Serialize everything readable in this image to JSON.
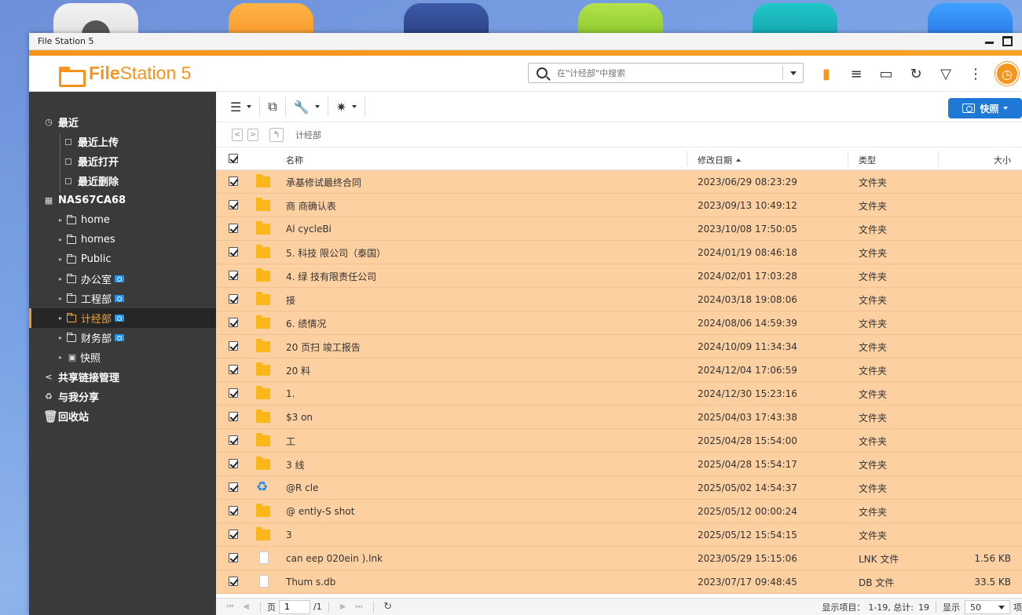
{
  "window": {
    "title": "File Station 5"
  },
  "app": {
    "brand_prefix": "File",
    "brand_suffix": "Station 5"
  },
  "search": {
    "placeholder": "在\"计经部\"中搜索"
  },
  "sidebar": {
    "recent": {
      "label": "最近",
      "children": [
        "最近上传",
        "最近打开",
        "最近删除"
      ]
    },
    "nas": {
      "label": "NAS67CA68"
    },
    "folders": [
      {
        "label": "home",
        "shared": false,
        "selected": false
      },
      {
        "label": "homes",
        "shared": false,
        "selected": false
      },
      {
        "label": "Public",
        "shared": false,
        "selected": false
      },
      {
        "label": "办公室",
        "shared": true,
        "selected": false
      },
      {
        "label": "工程部",
        "shared": true,
        "selected": false
      },
      {
        "label": "计经部",
        "shared": true,
        "selected": true
      },
      {
        "label": "财务部",
        "shared": true,
        "selected": false
      },
      {
        "label": "快照",
        "shared": false,
        "selected": false
      }
    ],
    "share_links": "共享链接管理",
    "shared_with_me": "与我分享",
    "recycle_bin": "回收站"
  },
  "toolbar": {
    "snapshot_label": "快照"
  },
  "path": {
    "current": "计经部"
  },
  "columns": {
    "name": "名称",
    "modified": "修改日期",
    "type": "类型",
    "size": "大小"
  },
  "files": [
    {
      "name": "承基修试最终合同",
      "modified": "2023/06/29 08:23:29",
      "type": "文件夹",
      "size": "",
      "icon": "folder"
    },
    {
      "name": "商 商确认表",
      "modified": "2023/09/13 10:49:12",
      "type": "文件夹",
      "size": "",
      "icon": "folder"
    },
    {
      "name": "Al cycleBi",
      "modified": "2023/10/08 17:50:05",
      "type": "文件夹",
      "size": "",
      "icon": "folder"
    },
    {
      "name": "5. 科技 限公司（泰国）",
      "modified": "2024/01/19 08:46:18",
      "type": "文件夹",
      "size": "",
      "icon": "folder"
    },
    {
      "name": "4. 绿 技有限责任公司",
      "modified": "2024/02/01 17:03:28",
      "type": "文件夹",
      "size": "",
      "icon": "folder"
    },
    {
      "name": "接",
      "modified": "2024/03/18 19:08:06",
      "type": "文件夹",
      "size": "",
      "icon": "folder"
    },
    {
      "name": "6. 绩情况",
      "modified": "2024/08/06 14:59:39",
      "type": "文件夹",
      "size": "",
      "icon": "folder"
    },
    {
      "name": "20 页扫 竣工报告",
      "modified": "2024/10/09 11:34:34",
      "type": "文件夹",
      "size": "",
      "icon": "folder"
    },
    {
      "name": "20 料",
      "modified": "2024/12/04 17:06:59",
      "type": "文件夹",
      "size": "",
      "icon": "folder"
    },
    {
      "name": "1.",
      "modified": "2024/12/30 15:23:16",
      "type": "文件夹",
      "size": "",
      "icon": "folder"
    },
    {
      "name": "$3 on",
      "modified": "2025/04/03 17:43:38",
      "type": "文件夹",
      "size": "",
      "icon": "folder"
    },
    {
      "name": "工",
      "modified": "2025/04/28 15:54:00",
      "type": "文件夹",
      "size": "",
      "icon": "folder"
    },
    {
      "name": "3 线",
      "modified": "2025/04/28 15:54:17",
      "type": "文件夹",
      "size": "",
      "icon": "folder"
    },
    {
      "name": "@R cle",
      "modified": "2025/05/02 14:54:37",
      "type": "文件夹",
      "size": "",
      "icon": "recycle"
    },
    {
      "name": "@ ently-S shot",
      "modified": "2025/05/12 00:00:24",
      "type": "文件夹",
      "size": "",
      "icon": "folder"
    },
    {
      "name": "3",
      "modified": "2025/05/12 15:54:15",
      "type": "文件夹",
      "size": "",
      "icon": "folder"
    },
    {
      "name": "can eep 020ein ).lnk",
      "modified": "2023/05/29 15:15:06",
      "type": "LNK 文件",
      "size": "1.56 KB",
      "icon": "file"
    },
    {
      "name": "Thum s.db",
      "modified": "2023/07/17 09:48:45",
      "type": "DB 文件",
      "size": "33.5 KB",
      "icon": "file"
    }
  ],
  "status": {
    "page_label": "页",
    "page": "1",
    "total_pages": "/1",
    "items_label": "显示项目：",
    "items_range": "1-19, 总计:",
    "items_total": "19",
    "show_label": "显示",
    "per_page": "50",
    "items_suffix": "项"
  }
}
